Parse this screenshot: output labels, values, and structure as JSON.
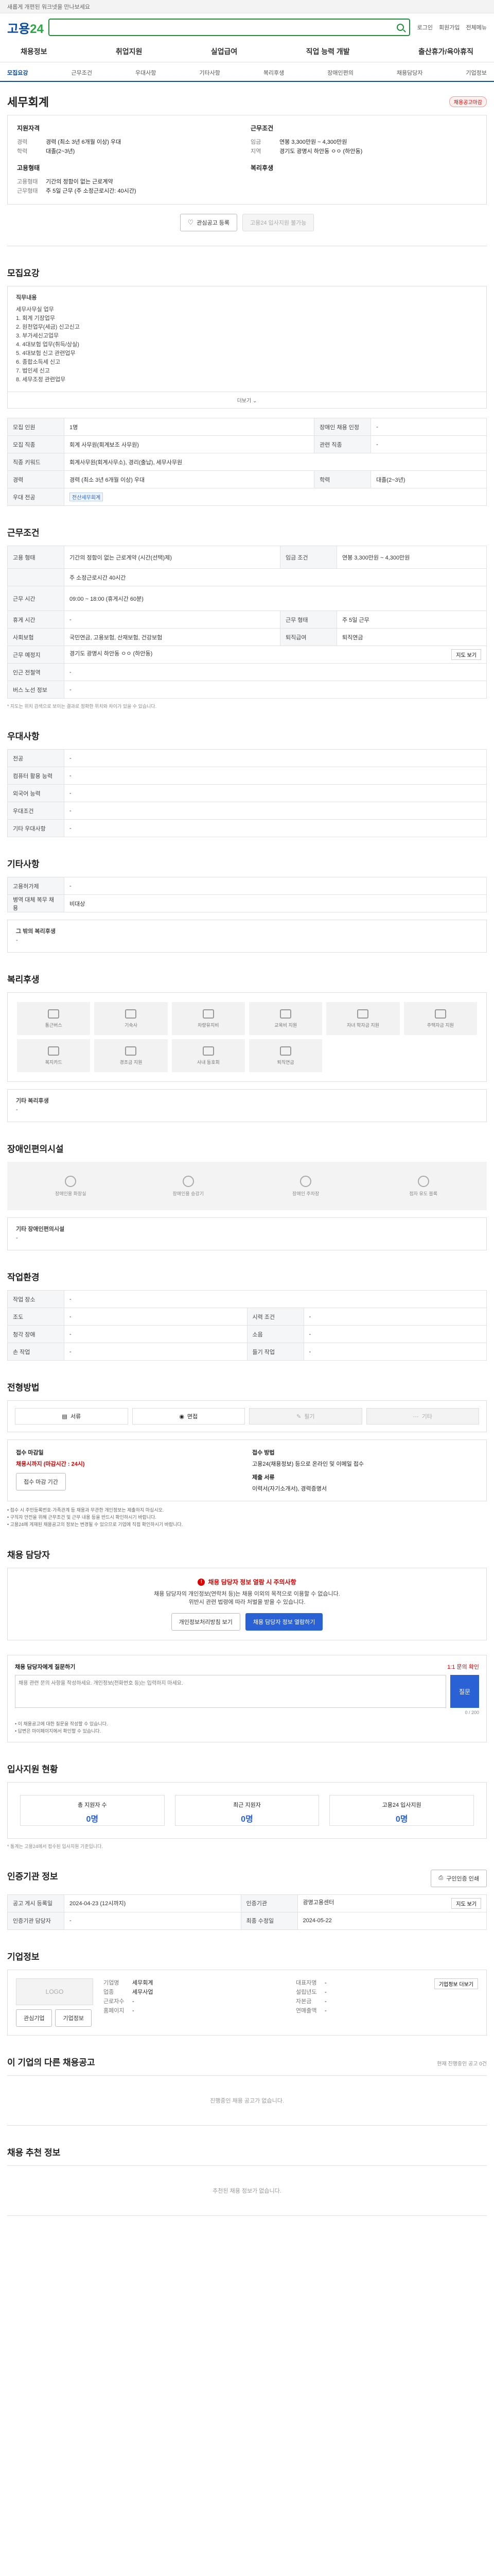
{
  "topbar": {
    "text": "새롭게 개편된 워크넷을 만나보세요"
  },
  "header": {
    "logo_main": "고용",
    "logo_num": "24",
    "search_placeholder": "",
    "links": [
      "로그인",
      "회원가입",
      "전체메뉴"
    ]
  },
  "gnb": [
    "채용정보",
    "취업지원",
    "실업급여",
    "직업 능력 개발",
    "출산휴가/육아휴직"
  ],
  "tabs": [
    "모집요강",
    "근무조건",
    "우대사항",
    "기타사항",
    "복리후생",
    "장애인편의",
    "채용담당자",
    "기업정보"
  ],
  "company": {
    "name": "세무회계",
    "badge": "채용공고마감"
  },
  "summary": {
    "left_title": "지원자격",
    "left": [
      {
        "k": "경력",
        "v": "경력 (최소 3년 6개월 이상) 우대"
      },
      {
        "k": "학력",
        "v": "대졸(2~3년)"
      }
    ],
    "right_title": "근무조건",
    "right": [
      {
        "k": "임금",
        "v": "연봉 3,300만원 ~ 4,300만원"
      },
      {
        "k": "지역",
        "v": "경기도 광명시 하안동 ㅇㅇ (하안동)"
      }
    ],
    "left_title2": "고용형태",
    "left2": [
      {
        "k": "고용형태",
        "v": "기간의 정함이 없는 근로계약"
      },
      {
        "k": "근무형태",
        "v": "주 5일 근무 (주 소정근로시간: 40시간)"
      }
    ],
    "right_title2": "복리후생",
    "right2": [],
    "btn_save": "관심공고 등록",
    "btn_apply": "고용24 입사지원 불가능"
  },
  "recruit": {
    "title": "모집요강",
    "duty_title": "직무내용",
    "duty_lines": [
      "세무사무실 업무",
      "1. 회계 기장업무",
      "2. 원천업무(세금) 신고신고",
      "3. 부가세신고업무",
      "4. 4대보험 업무(취득/상실)",
      "5. 4대보험 신고 관련업무",
      "6. 종합소득세 신고",
      "7. 법인세 신고",
      "8. 세무조정 관련업무"
    ],
    "more": "더보기",
    "rows": [
      [
        "모집 인원",
        "1명",
        "장애인 채용 인정",
        "-"
      ],
      [
        "모집 직종",
        "회계 사무원(회계보조 사무원)",
        "관련 직종",
        "-"
      ],
      [
        "직종 키워드",
        "회계사무원(회계사무소), 경리(출납), 세무사무원",
        "",
        ""
      ],
      [
        "경력",
        "경력 (최소 3년 6개월 이상) 우대",
        "학력",
        "대졸(2~3년)"
      ],
      [
        "우대 전공",
        "전산세무회계",
        "",
        ""
      ]
    ]
  },
  "conditions": {
    "title": "근무조건",
    "rows": [
      [
        "고용 형태",
        "기간의 정함이 없는 근로계약 (시간(선택)제)",
        "임금 조건",
        "연봉 3,300만원 ~ 4,300만원"
      ],
      [
        "근무 시간",
        "주 소정근로시간 40시간",
        "",
        ""
      ],
      [
        "근무 시간",
        "09:00 ~ 18:00 (휴게시간 60분)",
        "",
        ""
      ],
      [
        "휴게 시간",
        "-",
        "근무 형태",
        "주 5일 근무"
      ],
      [
        "사회보험",
        "국민연금, 고용보험, 산재보험, 건강보험",
        "퇴직급여",
        "퇴직연금"
      ],
      [
        "근무 예정지",
        "경기도 광명시 하안동 ㅇㅇ (하안동)",
        "",
        ""
      ],
      [
        "인근 전철역",
        "-",
        "",
        ""
      ],
      [
        "버스 노선 정보",
        "-",
        "",
        ""
      ]
    ],
    "note": "* 지도는 위치 검색으로 보이는 결과로 정확한 위치와 차이가 있을 수 있습니다.",
    "map_btn": "지도 보기"
  },
  "preference": {
    "title": "우대사항",
    "rows": [
      [
        "전공",
        "-"
      ],
      [
        "컴퓨터 활용 능력",
        "-"
      ],
      [
        "외국어 능력",
        "-"
      ],
      [
        "우대조건",
        "-"
      ],
      [
        "기타 우대사항",
        "-"
      ]
    ]
  },
  "etc": {
    "title": "기타사항",
    "rows": [
      [
        "고용허가제",
        "-"
      ],
      [
        "병역 대체 복무 채용",
        "비대상"
      ]
    ],
    "sub_title": "그 밖의 복리후생",
    "sub_value": "-"
  },
  "benefits": {
    "title": "복리후생",
    "items": [
      "통근버스",
      "기숙사",
      "차량유지비",
      "교육비 지원",
      "자녀 학자금 지원",
      "주택자금 지원",
      "복지카드",
      "경조금 지원",
      "사내 동호회",
      "퇴직연금"
    ],
    "sub_title": "기타 복리후생",
    "sub_value": "-"
  },
  "disability": {
    "title": "장애인편의시설",
    "items": [
      "장애인용 화장실",
      "장애인용 승강기",
      "장애인 주차장",
      "점자 유도 블록"
    ],
    "sub_title": "기타 장애인편의시설",
    "sub_value": "-"
  },
  "workplace": {
    "title": "작업환경",
    "rows": [
      [
        "작업 장소",
        "-",
        "",
        ""
      ],
      [
        "조도",
        "-",
        "시력 조건",
        "-"
      ],
      [
        "청각 장애",
        "-",
        "소음",
        "-"
      ],
      [
        "손 작업",
        "-",
        "들기 작업",
        "-"
      ]
    ]
  },
  "method": {
    "title": "전형방법",
    "items": [
      "서류",
      "면접",
      "필기",
      "기타"
    ],
    "apply_title": "접수 마감일",
    "apply_value": "채용시까지 (마감시간 : 24시)",
    "apply_btn": "접수 마감 기간",
    "doc_title": "접수 방법",
    "doc_value": "고용24(채용정보) 등으로 온라인 및 이메일 접수",
    "doc_title2": "제출 서류",
    "doc_value2": "이력서(자기소개서), 경력증명서",
    "bullets": [
      "• 접수 시 주민등록번호·가족관계 등 채용과 무관한 개인정보는 제출하지 마십시오.",
      "• 구직자 안전을 위해 근무조건 및 근무 내용 등을 반드시 확인하시기 바랍니다.",
      "• 고용24에 게재된 채용공고의 정보는 변경될 수 있으므로 기업에 직접 확인하시기 바랍니다."
    ]
  },
  "manager": {
    "title": "채용 담당자",
    "warn": "채용 담당자 정보 열람 시 주의사항",
    "lines": [
      "채용 담당자의 개인정보(연락처 등)는 채용 이외의 목적으로 이용할 수 없습니다.",
      "위반시 관련 법령에 따라 처벌을 받을 수 있습니다."
    ],
    "btn_policy": "개인정보처리방침 보기",
    "btn_view": "채용 담당자 정보 열람하기"
  },
  "inquiry": {
    "title": "채용 담당자에게 질문하기",
    "guide": "1:1 문의 확인",
    "placeholder": "채용 관련 문의 사항을 작성하세요. 개인정보(전화번호 등)는 입력하지 마세요.",
    "btn": "질문",
    "count": "0 / 200",
    "bullets": [
      "• 이 채용공고에 대한 질문을 작성할 수 있습니다.",
      "• 답변은 마이페이지에서 확인할 수 있습니다."
    ]
  },
  "stats": {
    "title": "입사지원 현황",
    "items": [
      {
        "label": "총 지원자 수",
        "value": "0명"
      },
      {
        "label": "최근 지원자",
        "value": "0명"
      },
      {
        "label": "고용24 입사지원",
        "value": "0명"
      }
    ],
    "note": "* 통계는 고용24에서 접수된 입사지원 기준입니다."
  },
  "info": {
    "title": "인증기관 정보",
    "print_btn": "구인인증 인쇄",
    "rows": [
      [
        "공고 게시 등록일",
        "2024-04-23 (12시까지)",
        "인증기관",
        "광명고용센터"
      ],
      [
        "인증기관 담당자",
        "-",
        "최종 수정일",
        "2024-05-22"
      ]
    ],
    "map_btn": "지도 보기"
  },
  "company_info": {
    "title": "기업정보",
    "logo_text": "LOGO",
    "btn_follow": "관심기업",
    "btn_more": "기업정보",
    "rows_left": [
      [
        "기업명",
        "세무회계"
      ],
      [
        "업종",
        "세무사업"
      ],
      [
        "근로자수",
        "-"
      ],
      [
        "홈페이지",
        "-"
      ]
    ],
    "rows_right": [
      [
        "대표자명",
        "-"
      ],
      [
        "설립년도",
        "-"
      ],
      [
        "자본금",
        "-"
      ],
      [
        "연매출액",
        "-"
      ]
    ],
    "detail_btn": "기업정보 더보기"
  },
  "other_jobs": {
    "title": "이 기업의 다른 채용공고",
    "sub": "현재 진행중인 공고 0건",
    "empty": "진행중인 채용 공고가 없습니다."
  },
  "recommend": {
    "title": "채용 추천 정보",
    "empty": "추천된 채용 정보가 없습니다."
  }
}
